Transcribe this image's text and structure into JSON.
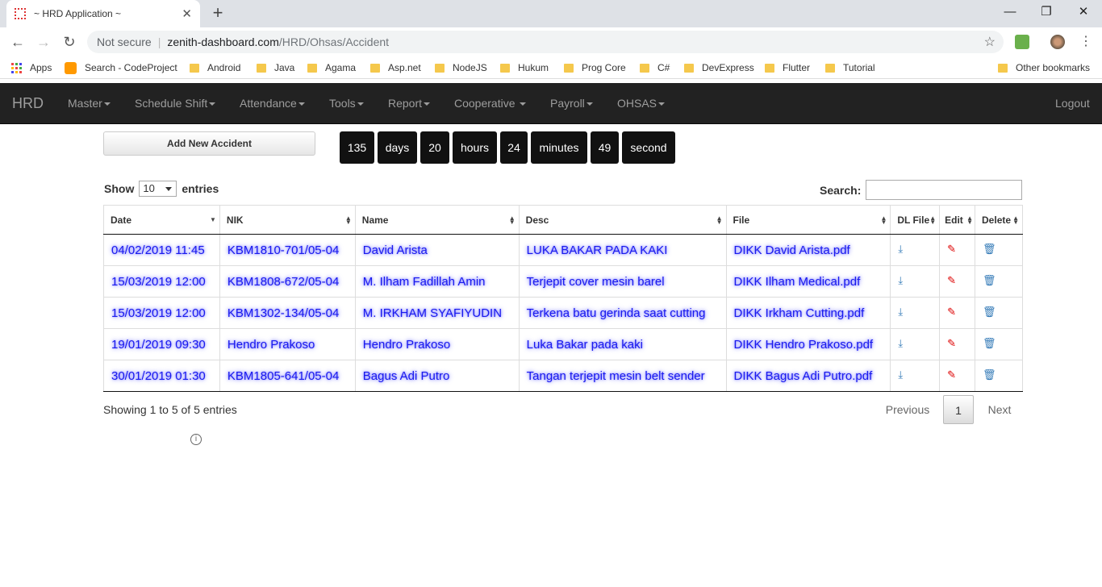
{
  "browser": {
    "tab_title": "~ HRD Application ~",
    "new_tab": "+",
    "url_security": "Not secure",
    "url_host": "zenith-dashboard.com",
    "url_path": "/HRD/Ohsas/Accident",
    "bookmarks": [
      "Apps",
      "Search - CodeProject",
      "Android",
      "Java",
      "Agama",
      "Asp.net",
      "NodeJS",
      "Hukum",
      "Prog Core",
      "C#",
      "DevExpress",
      "Flutter",
      "Tutorial"
    ],
    "other_bookmarks": "Other bookmarks"
  },
  "navbar": {
    "brand": "HRD",
    "menus": [
      "Master",
      "Schedule Shift",
      "Attendance",
      "Tools",
      "Report",
      "Cooperative",
      "Payroll",
      "OHSAS"
    ],
    "logout": "Logout"
  },
  "actions": {
    "add_label": "Add New Accident"
  },
  "countdown": [
    "135",
    "days",
    "20",
    "hours",
    "24",
    "minutes",
    "49",
    "second"
  ],
  "table_controls": {
    "show": "Show",
    "length_value": "10",
    "entries": "entries",
    "search_label": "Search:"
  },
  "table": {
    "headers": [
      "Date",
      "NIK",
      "Name",
      "Desc",
      "File",
      "DL File",
      "Edit",
      "Delete"
    ],
    "rows": [
      [
        "04/02/2019 11:45",
        "KBM1810-701/05-04",
        "David Arista",
        "LUKA BAKAR PADA KAKI",
        "DIKK David Arista.pdf"
      ],
      [
        "15/03/2019 12:00",
        "KBM1808-672/05-04",
        "M. Ilham Fadillah Amin",
        "Terjepit cover mesin barel",
        "DIKK Ilham Medical.pdf"
      ],
      [
        "15/03/2019 12:00",
        "KBM1302-134/05-04",
        "M. IRKHAM SYAFIYUDIN",
        "Terkena batu gerinda saat cutting",
        "DIKK Irkham Cutting.pdf"
      ],
      [
        "19/01/2019 09:30",
        "Hendro Prakoso",
        "Hendro Prakoso",
        "Luka Bakar pada kaki",
        "DIKK Hendro Prakoso.pdf"
      ],
      [
        "30/01/2019 01:30",
        "KBM1805-641/05-04",
        "Bagus Adi Putro",
        "Tangan terjepit mesin belt sender",
        "DIKK Bagus Adi Putro.pdf"
      ]
    ]
  },
  "pagination": {
    "info": "Showing 1 to 5 of 5 entries",
    "previous": "Previous",
    "page": "1",
    "next": "Next"
  }
}
